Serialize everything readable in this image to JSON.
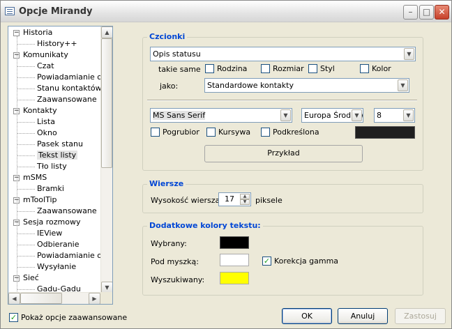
{
  "window": {
    "title": "Opcje Mirandy"
  },
  "tree": {
    "items": [
      {
        "label": "Historia",
        "level": 0,
        "expanded": true
      },
      {
        "label": "History++",
        "level": 1
      },
      {
        "label": "Komunikaty",
        "level": 0,
        "expanded": true
      },
      {
        "label": "Czat",
        "level": 1
      },
      {
        "label": "Powiadamianie o pis",
        "level": 1
      },
      {
        "label": "Stanu kontaktów",
        "level": 1
      },
      {
        "label": "Zaawansowane",
        "level": 1
      },
      {
        "label": "Kontakty",
        "level": 0,
        "expanded": true
      },
      {
        "label": "Lista",
        "level": 1
      },
      {
        "label": "Okno",
        "level": 1
      },
      {
        "label": "Pasek stanu",
        "level": 1
      },
      {
        "label": "Tekst listy",
        "level": 1,
        "selected": true
      },
      {
        "label": "Tło listy",
        "level": 1
      },
      {
        "label": "mSMS",
        "level": 0,
        "expanded": true
      },
      {
        "label": "Bramki",
        "level": 1
      },
      {
        "label": "mToolTip",
        "level": 0,
        "expanded": true
      },
      {
        "label": "Zaawansowane",
        "level": 1
      },
      {
        "label": "Sesja rozmowy",
        "level": 0,
        "expanded": true
      },
      {
        "label": "IEView",
        "level": 1
      },
      {
        "label": "Odbieranie",
        "level": 1
      },
      {
        "label": "Powiadamianie o pis",
        "level": 1
      },
      {
        "label": "Wysyłanie",
        "level": 1
      },
      {
        "label": "Sieć",
        "level": 0,
        "expanded": true
      },
      {
        "label": "Gadu-Gadu",
        "level": 1
      }
    ]
  },
  "show_advanced": {
    "label": "Pokaż opcje zaawansowane",
    "checked": true
  },
  "fonts": {
    "title": "Czcionki",
    "item_select": "Opis statusu",
    "same_label": "takie same",
    "same_opts": [
      {
        "label": "Rodzina",
        "checked": false
      },
      {
        "label": "Rozmiar",
        "checked": false
      },
      {
        "label": "Styl",
        "checked": false
      },
      {
        "label": "Kolor",
        "checked": false
      }
    ],
    "as_label": "jako:",
    "as_select": "Standardowe kontakty",
    "font_name": "MS Sans Serif",
    "script": "Europa Środkowa",
    "size": "8",
    "styles": [
      {
        "label": "Pogrubiona",
        "checked": false
      },
      {
        "label": "Kursywa",
        "checked": false
      },
      {
        "label": "Podkreślona",
        "checked": false
      }
    ],
    "font_color": "#1f1f1f",
    "preview": "Przykład"
  },
  "rows": {
    "title": "Wiersze",
    "height_label": "Wysokość wiersza:",
    "height_value": "17",
    "unit": "piksele"
  },
  "colors": {
    "title": "Dodatkowe kolory tekstu:",
    "selected_label": "Wybrany:",
    "selected_color": "#000000",
    "hover_label": "Pod myszką:",
    "hover_color": "#ffffff",
    "gamma_label": "Korekcja gamma",
    "gamma_checked": true,
    "search_label": "Wyszukiwany:",
    "search_color": "#ffff00"
  },
  "buttons": {
    "ok": "OK",
    "cancel": "Anuluj",
    "apply": "Zastosuj"
  }
}
